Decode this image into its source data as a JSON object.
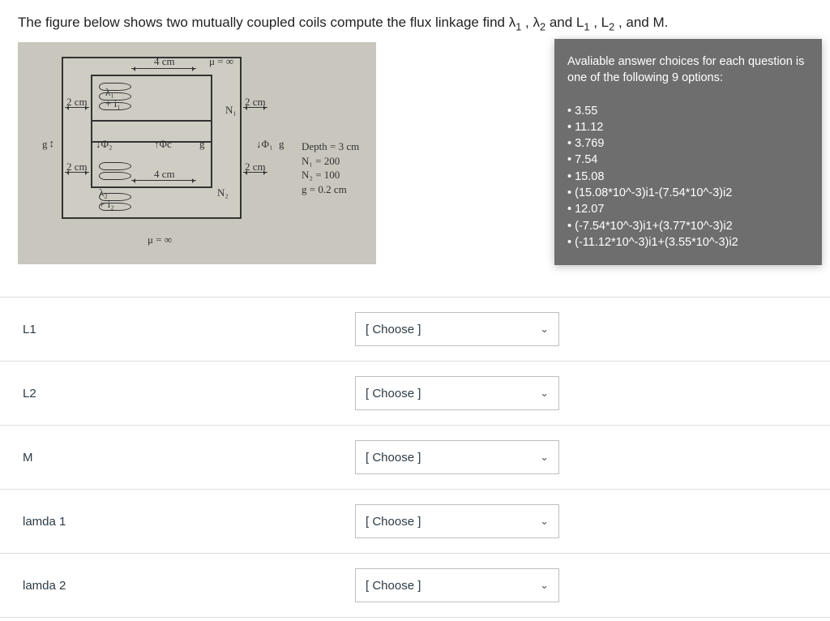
{
  "question": {
    "prefix": "The figure below shows two mutually coupled coils compute the flux linkage find ",
    "lambda1": "λ",
    "lambda1_sub": "1",
    "comma1": ", ",
    "lambda2": "λ",
    "lambda2_sub": "2",
    "mid": " and L",
    "l1_sub": "1",
    "l2_pre": ", L",
    "l2_sub": "2",
    "tail": ", and M."
  },
  "figure": {
    "mu_inf_top": "μ = ∞",
    "mu_inf_bot": "μ = ∞",
    "dim_4cm_top": "4 cm",
    "dim_4cm_bot": "4 cm",
    "dim_2cm_l1": "2 cm",
    "dim_2cm_l2": "2 cm",
    "dim_2cm_r1": "2 cm",
    "dim_2cm_r2": "2 cm",
    "g1": "g",
    "g2": "g",
    "g3": "g",
    "n1": "N₁",
    "n2": "N₂",
    "i1": "+ i₁",
    "i2": "+ i₂",
    "l1": "λ₁",
    "l2": "λ₂",
    "phi1": "Φ₁",
    "phi2": "Φ₂",
    "phic": "Φc",
    "params": {
      "depth": "Depth  =  3 cm",
      "n1": "N₁  =  200",
      "n2": "N₂  =  100",
      "g": "g  =  0.2 cm"
    }
  },
  "tooltip": {
    "intro": "Avaliable answer choices for each question is one of the following 9 options:",
    "opts": [
      "3.55",
      "11.12",
      "3.769",
      "7.54",
      "15.08",
      "(15.08*10^-3)i1-(7.54*10^-3)i2",
      "12.07",
      "(-7.54*10^-3)i1+(3.77*10^-3)i2",
      "(-11.12*10^-3)i1+(3.55*10^-3)i2"
    ]
  },
  "rows": [
    {
      "label": "L1"
    },
    {
      "label": "L2"
    },
    {
      "label": "M"
    },
    {
      "label": "lamda 1"
    },
    {
      "label": "lamda 2"
    }
  ],
  "choose_placeholder": "[ Choose ]"
}
